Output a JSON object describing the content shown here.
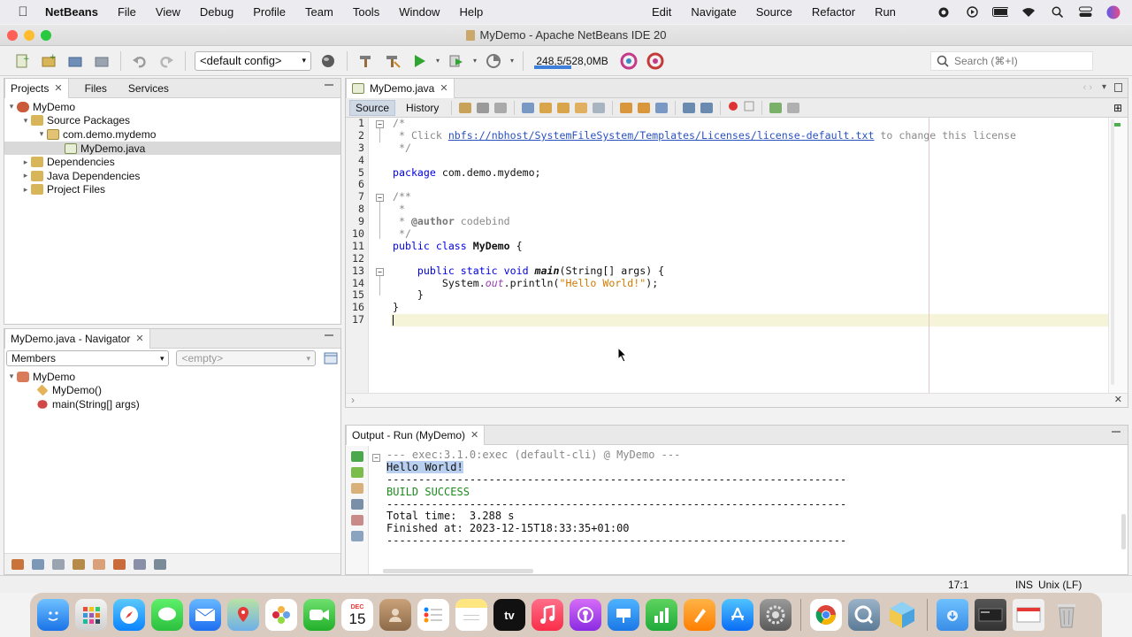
{
  "menubar": {
    "app_name": "NetBeans",
    "left_menus": [
      "File",
      "View",
      "Debug",
      "Profile",
      "Team",
      "Tools",
      "Window",
      "Help"
    ],
    "right_menus": [
      "Edit",
      "Navigate",
      "Source",
      "Refactor",
      "Run"
    ]
  },
  "window": {
    "title": "MyDemo - Apache NetBeans IDE 20"
  },
  "toolbar": {
    "config": "<default config>",
    "memory": "248,5/528,0MB",
    "memory_fraction": 0.47,
    "search_placeholder": "Search (⌘+I)"
  },
  "projects": {
    "tabs": [
      "Projects",
      "Files",
      "Services"
    ],
    "tree": [
      {
        "label": "MyDemo",
        "level": 0,
        "expanded": true,
        "icon": "project-icon"
      },
      {
        "label": "Source Packages",
        "level": 1,
        "expanded": true,
        "icon": "source-packages-icon"
      },
      {
        "label": "com.demo.mydemo",
        "level": 2,
        "expanded": true,
        "icon": "package-icon"
      },
      {
        "label": "MyDemo.java",
        "level": 3,
        "expanded": null,
        "icon": "java-file-icon",
        "selected": true
      },
      {
        "label": "Dependencies",
        "level": 1,
        "expanded": false,
        "icon": "dependencies-icon"
      },
      {
        "label": "Java Dependencies",
        "level": 1,
        "expanded": false,
        "icon": "java-dependencies-icon"
      },
      {
        "label": "Project Files",
        "level": 1,
        "expanded": false,
        "icon": "project-files-icon"
      }
    ]
  },
  "navigator": {
    "tab": "MyDemo.java - Navigator",
    "filter": "Members",
    "secondary": "<empty>",
    "items": [
      {
        "label": "MyDemo",
        "level": 0
      },
      {
        "label": "MyDemo()",
        "level": 1
      },
      {
        "label": "main(String[] args)",
        "level": 1
      }
    ]
  },
  "editor": {
    "tab": "MyDemo.java",
    "modes": [
      "Source",
      "History"
    ],
    "lines": [
      "1",
      "2",
      "3",
      "4",
      "5",
      "6",
      "7",
      "8",
      "9",
      "10",
      "11",
      "12",
      "13",
      "14",
      "15",
      "16",
      "17"
    ],
    "code": {
      "l1": "/*",
      "l2a": " * Click ",
      "l2link": "nbfs://nbhost/SystemFileSystem/Templates/Licenses/license-default.txt",
      "l2b": " to change this license",
      "l3": " */",
      "l5kw": "package",
      "l5": " com.demo.mydemo;",
      "l7": "/**",
      "l8": " *",
      "l9a": " * ",
      "l9tag": "@author",
      "l9b": " codebind",
      "l10": " */",
      "l11kw": "public class",
      "l11name": "MyDemo",
      "l11b": " {",
      "l13kw": "public static void",
      "l13name": "main",
      "l13b": "(String[] args) {",
      "l14a": "System.",
      "l14out": "out",
      "l14b": ".println(",
      "l14str": "\"Hello World!\"",
      "l14c": ");",
      "l15": "}",
      "l16": "}"
    }
  },
  "output": {
    "tab": "Output - Run (MyDemo)",
    "exec_line": "--- exec:3.1.0:exec (default-cli) @ MyDemo ---",
    "hello": "Hello World!",
    "separator": "------------------------------------------------------------------------",
    "build": "BUILD SUCCESS",
    "total_time": "Total time:  3.288 s",
    "finished": "Finished at: 2023-12-15T18:33:35+01:00"
  },
  "statusbar": {
    "position": "17:1",
    "mode": "INS",
    "line_ending": "Unix (LF)"
  },
  "dock": {
    "calendar_month": "DEC",
    "calendar_day": "15",
    "tv_label": "tv"
  },
  "colors": {
    "accent": "#3d7fd9",
    "build_success": "#1e8a1e",
    "selection": "#b8cff0"
  }
}
